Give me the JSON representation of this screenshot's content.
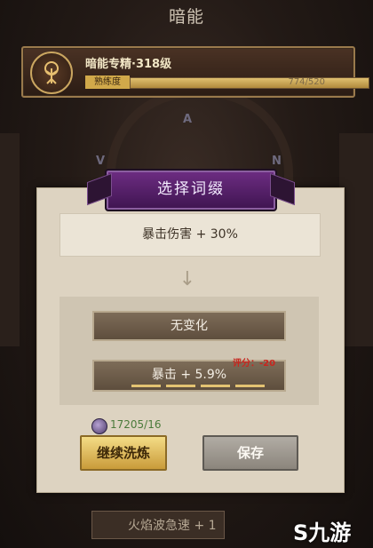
{
  "header": {
    "title": "暗能"
  },
  "spec": {
    "title": "暗能专精·318级",
    "proficiency_label": "熟练度",
    "proficiency_text": "774/520",
    "proficiency_fraction": 1.0
  },
  "modal": {
    "title": "选择词缀",
    "current_affix": "暴击伤害 + 30%",
    "arrow": "↓",
    "options": [
      {
        "label": "无变化"
      },
      {
        "label": "暴击 + 5.9%",
        "score_text": "评分：-20",
        "tick_count": 4
      }
    ],
    "cost_text": "17205/16",
    "continue_label": "继续洗炼",
    "save_label": "保存"
  },
  "bottom": {
    "label": "火焰波急速 + 1"
  },
  "runes": [
    "A",
    "N",
    "V"
  ],
  "watermark": {
    "text": "九游"
  },
  "colors": {
    "header_purple": "#5a2270",
    "continue_gold": "#e2be5c",
    "save_gray": "#9d978f",
    "score_red": "#c8261f",
    "cost_green": "#4a7a3a"
  }
}
